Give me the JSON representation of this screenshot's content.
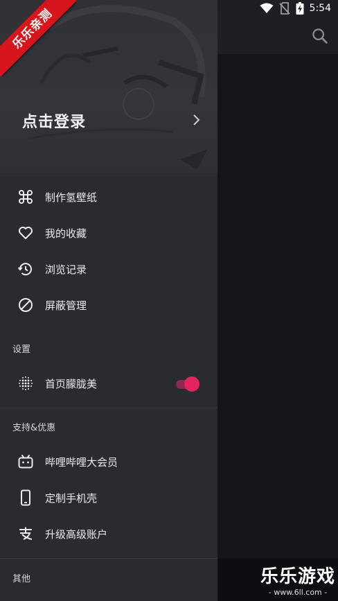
{
  "status_bar": {
    "time": "5:54"
  },
  "header": {
    "login_label": "点击登录"
  },
  "menu": [
    {
      "icon": "command-icon",
      "label": "制作氢壁纸"
    },
    {
      "icon": "heart-icon",
      "label": "我的收藏"
    },
    {
      "icon": "history-icon",
      "label": "浏览记录"
    },
    {
      "icon": "block-icon",
      "label": "屏蔽管理"
    }
  ],
  "settings": {
    "title": "设置",
    "items": [
      {
        "icon": "dots-grid-icon",
        "label": "首页朦胧美",
        "toggle_on": true
      }
    ]
  },
  "support": {
    "title": "支持&优惠",
    "items": [
      {
        "icon": "bilibili-icon",
        "label": "哔哩哔哩大会员"
      },
      {
        "icon": "phone-icon",
        "label": "定制手机壳"
      },
      {
        "icon": "alipay-icon",
        "label": "升级高级账户"
      }
    ]
  },
  "other": {
    "title": "其他"
  },
  "watermark": {
    "ribbon": "乐乐亲测",
    "brand": "乐乐游戏",
    "url": "- www.6ll.com -"
  },
  "colors": {
    "accent": "#e3245f",
    "drawer_bg": "#2a2a31",
    "app_bg": "#141419"
  }
}
